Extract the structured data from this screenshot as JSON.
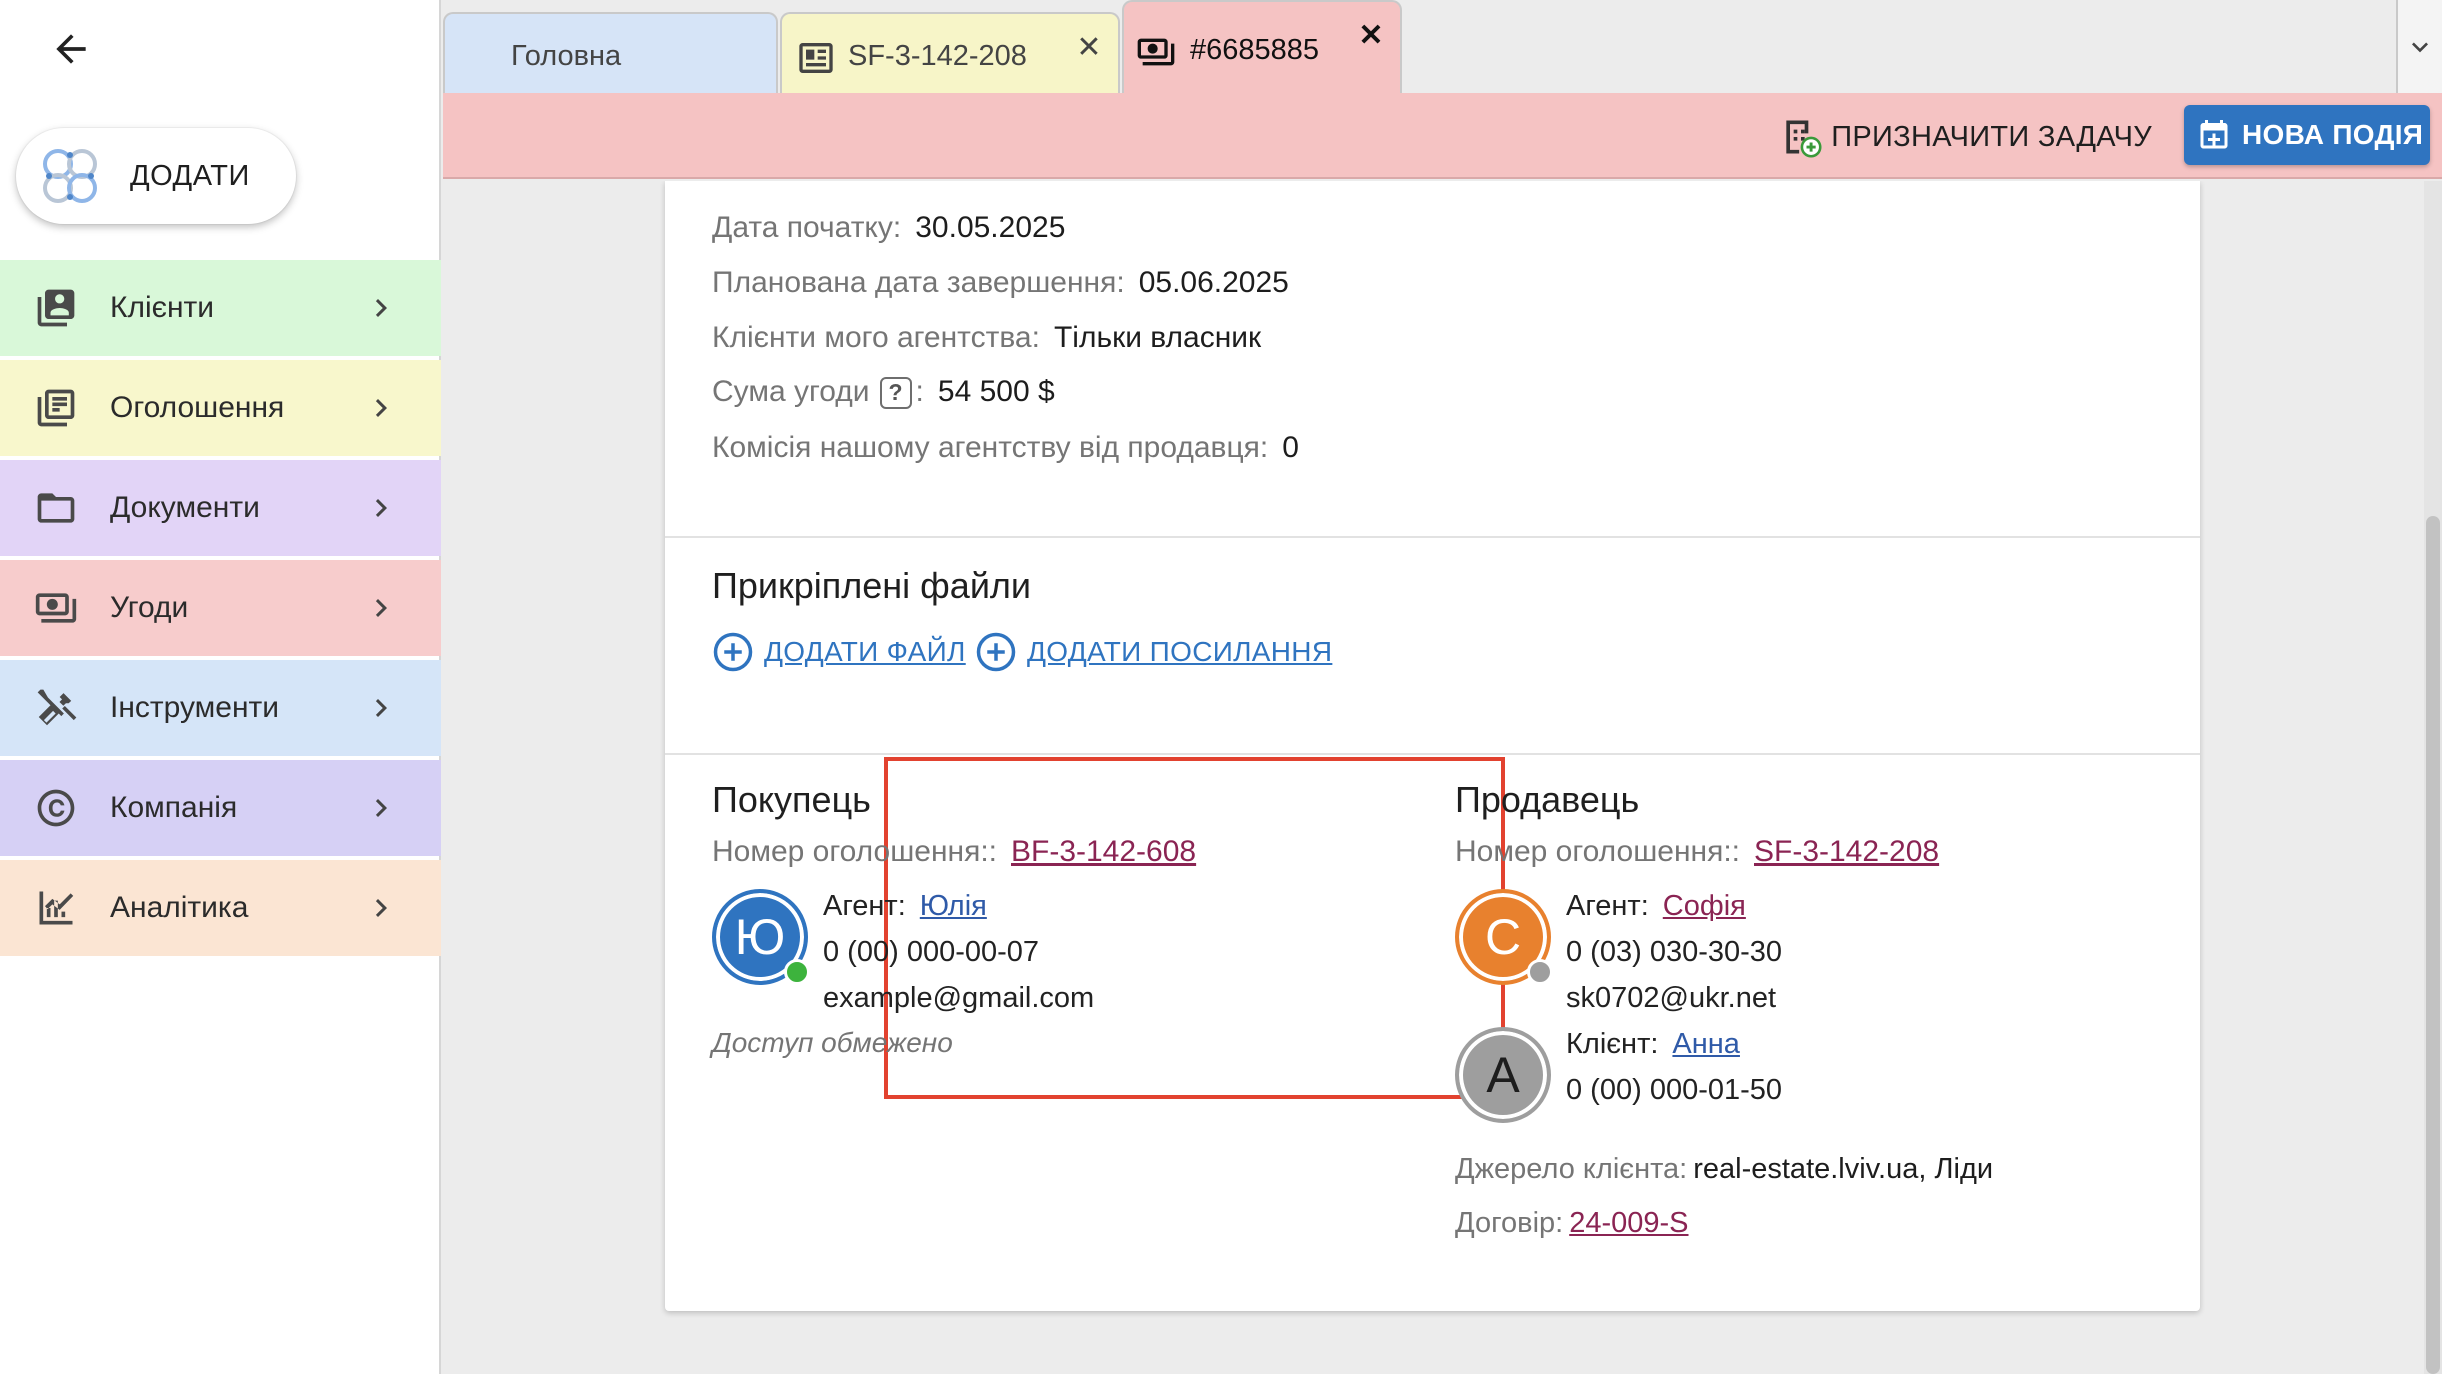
{
  "sidebar": {
    "add_label": "ДОДАТИ",
    "items": [
      {
        "label": "Клієнти",
        "icon": "contacts-icon",
        "bg": "#d9f8d9"
      },
      {
        "label": "Оголошення",
        "icon": "listing-icon",
        "bg": "#f8f7cc"
      },
      {
        "label": "Документи",
        "icon": "folder-icon",
        "bg": "#e2d4f7"
      },
      {
        "label": "Угоди",
        "icon": "money-icon",
        "bg": "#f7cccc"
      },
      {
        "label": "Інструменти",
        "icon": "tools-icon",
        "bg": "#d5e5f8"
      },
      {
        "label": "Компанія",
        "icon": "copyright-icon",
        "bg": "#d6d0f5"
      },
      {
        "label": "Аналітика",
        "icon": "analytics-icon",
        "bg": "#fbe5d3"
      }
    ]
  },
  "tabs": [
    {
      "label": "Головна"
    },
    {
      "label": "SF-3-142-208",
      "close": "✕"
    },
    {
      "label": "#6685885",
      "close": "✕"
    }
  ],
  "actions": {
    "assign_task": "ПРИЗНАЧИТИ ЗАДАЧУ",
    "new_event": "НОВА ПОДІЯ"
  },
  "deal": {
    "fields": [
      {
        "label": "Дата початку:",
        "value": "30.05.2025"
      },
      {
        "label": "Планована дата завершення:",
        "value": "05.06.2025"
      },
      {
        "label": "Клієнти мого агентства:",
        "value": "Тільки власник"
      },
      {
        "label": "Сума угоди",
        "help": "?",
        "colon": ":",
        "value": "54 500 $"
      },
      {
        "label": "Комісія нашому агентству від продавця:",
        "value": "0"
      }
    ],
    "attachments": {
      "title": "Прикріплені файли",
      "add_file": "ДОДАТИ ФАЙЛ",
      "add_link": "ДОДАТИ ПОСИЛАННЯ"
    },
    "buyer": {
      "title": "Покупець",
      "listing_label": "Номер оголошення::",
      "listing_number": "BF-3-142-608",
      "agent_label": "Агент:",
      "agent_name": "Юлія",
      "avatar_letter": "Ю",
      "avatar_color": "#2f74c0",
      "status_color": "#3db33d",
      "phone": "0 (00) 000-00-07",
      "email": "example@gmail.com",
      "note": "Доступ обмежено"
    },
    "seller": {
      "title": "Продавець",
      "listing_label": "Номер оголошення::",
      "listing_number": "SF-3-142-208",
      "agent_label": "Агент:",
      "agent_name": "Софія",
      "avatar_letter": "С",
      "avatar_color": "#e8812e",
      "status_color": "#9e9e9e",
      "phone": "0 (03) 030-30-30",
      "email": "sk0702@ukr.net",
      "client_label": "Клієнт:",
      "client_name": "Анна",
      "client_letter": "А",
      "client_color": "#9e9e9e",
      "client_phone": "0 (00) 000-01-50",
      "source_label": "Джерело клієнта:",
      "source_value": "real-estate.lviv.ua, Ліди",
      "contract_label": "Договір:",
      "contract_value": "24-009-S"
    }
  }
}
